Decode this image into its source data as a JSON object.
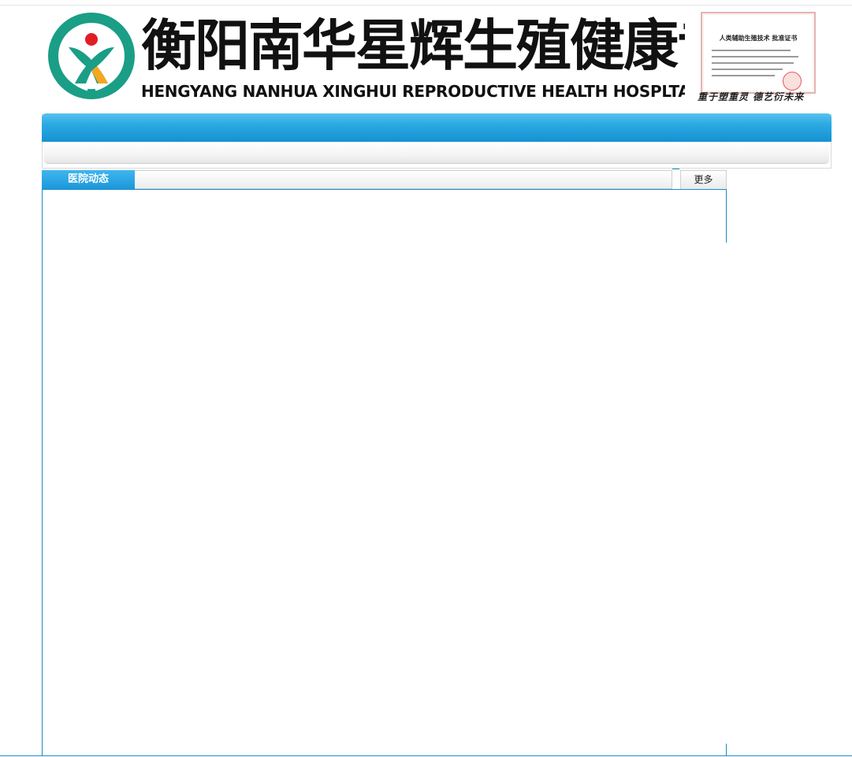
{
  "header": {
    "title_cn": "衡阳南华星辉生殖健康专科医院",
    "title_en": "HENGYANG NANHUA XINGHUI REPRODUCTIVE HEALTH HOSPLTAL",
    "slogan": "重于塑重灵 德艺衍未来",
    "certificate": {
      "heading": "人类辅助生殖技术 批准证书"
    },
    "colors": {
      "logo_ring": "#1a9e86",
      "logo_red": "#e11d24",
      "logo_orange": "#f5a623"
    }
  },
  "nav": {
    "colors": {
      "bar_top": "#56c2ee",
      "bar_bottom": "#1592d2"
    }
  },
  "panel": {
    "tab_label": "医院动态",
    "more_label": "更多",
    "colors": {
      "accent": "#1a8fc8"
    }
  }
}
